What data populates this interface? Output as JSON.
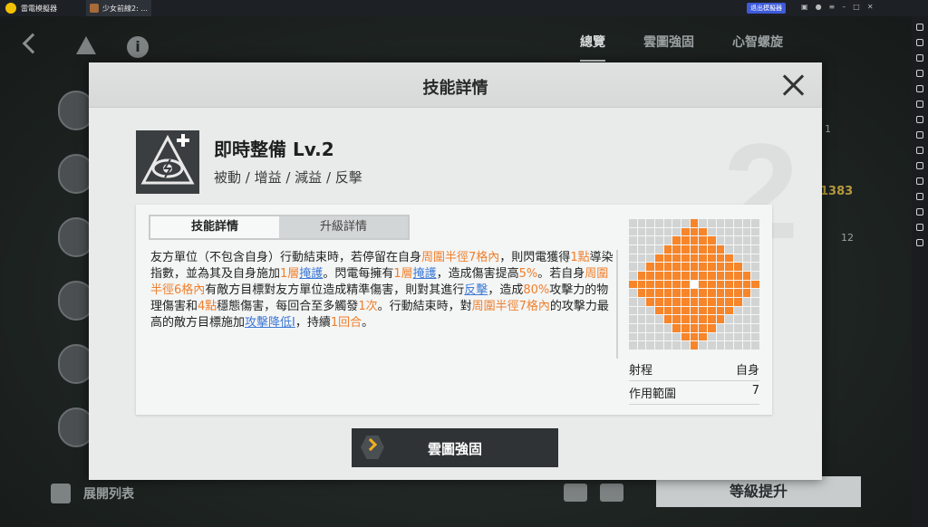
{
  "titlebar": {
    "app_name": "雷電模擬器",
    "tab_title": "少女前線2: ...",
    "tab_close": "✕",
    "exit_button": "退出模擬器",
    "icons": [
      "gamepad-icon",
      "user-icon",
      "menu-icon",
      "minimize-icon",
      "maximize-icon",
      "close-icon"
    ]
  },
  "background": {
    "tabs": [
      "總覽",
      "雲圖強固",
      "心智螺旋"
    ],
    "active_tab": "總覽",
    "side_values": [
      "1",
      "1383",
      "12"
    ],
    "bottom_left_label": "展開列表",
    "level_up": "等級提升"
  },
  "modal": {
    "title": "技能詳情",
    "skill": {
      "name": "即時整備 Lv.2",
      "tags": "被動 / 增益 / 減益 / 反擊",
      "icon": "eye-lightning-icon"
    },
    "tabs": [
      "技能詳情",
      "升級詳情"
    ],
    "active_tab": "技能詳情",
    "description": [
      {
        "t": "友方單位（不包含自身）行動結束時，若停留在自身"
      },
      {
        "t": "周圍半徑7格內",
        "s": "hl"
      },
      {
        "t": "，則閃電獲得"
      },
      {
        "t": "1點",
        "s": "hl"
      },
      {
        "t": "導染指數，並為其及自身施加"
      },
      {
        "t": "1層",
        "s": "hl"
      },
      {
        "t": "掩護",
        "s": "kw"
      },
      {
        "t": "。閃電每擁有"
      },
      {
        "t": "1層",
        "s": "hl"
      },
      {
        "t": "掩護",
        "s": "kw"
      },
      {
        "t": "，造成傷害提高"
      },
      {
        "t": "5%",
        "s": "hl"
      },
      {
        "t": "。若自身"
      },
      {
        "t": "周圍半徑6格內",
        "s": "hl"
      },
      {
        "t": "有敵方目標對友方單位造成精準傷害，則對其進行"
      },
      {
        "t": "反擊",
        "s": "kw"
      },
      {
        "t": "，造成"
      },
      {
        "t": "80%",
        "s": "hl"
      },
      {
        "t": "攻擊力的物理傷害和"
      },
      {
        "t": "4點",
        "s": "hl"
      },
      {
        "t": "穩態傷害，每回合至多觸發"
      },
      {
        "t": "1次",
        "s": "hl"
      },
      {
        "t": "。行動結束時，對"
      },
      {
        "t": "周圍半徑7格內",
        "s": "hl"
      },
      {
        "t": "的攻擊力最高的敵方目標施加"
      },
      {
        "t": "攻擊降低I",
        "s": "kw"
      },
      {
        "t": "，持續"
      },
      {
        "t": "1回合",
        "s": "hl"
      },
      {
        "t": "。"
      }
    ],
    "range_grid": {
      "size": 15,
      "radius": 7
    },
    "stats": [
      {
        "label": "射程",
        "value": "自身"
      },
      {
        "label": "作用範圍",
        "value": "7"
      }
    ],
    "watermark": "2",
    "enhance_button": "雲圖強固",
    "colors": {
      "highlight": "#f07f2a",
      "keyword": "#3d7ad6",
      "grid_on": "#f7852a"
    }
  }
}
